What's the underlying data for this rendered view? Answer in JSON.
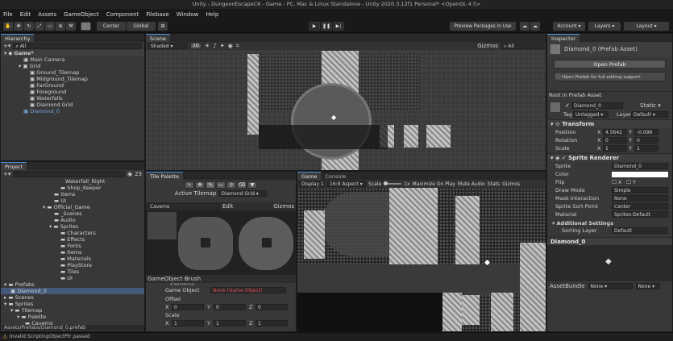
{
  "title": "Unity - DungeonEscapeC6 - Game - PC, Mac & Linux Standalone - Unity 2020.3.12f1 Personal* <OpenGL 4.5>",
  "menu": [
    "File",
    "Edit",
    "Assets",
    "GameObject",
    "Component",
    "Filebase",
    "Window",
    "Help"
  ],
  "toolbar": {
    "center": "Center",
    "global": "Global",
    "preview": "Preview Packages in Use",
    "account": "Account",
    "layers": "Layers",
    "layout": "Layout"
  },
  "hierarchy": {
    "tab": "Hierarchy",
    "search": "All",
    "items": [
      "Game*",
      "Main Camera",
      "Grid",
      "Ground_Tilemap",
      "Midground_Tilemap",
      "FarGround",
      "Foreground",
      "Waterfalls",
      "Diamond Grid",
      "Diamond_0"
    ]
  },
  "scene": {
    "tab": "Scene",
    "shading": "Shaded",
    "mode": "2D",
    "gizmos": "Gizmos",
    "search": "All"
  },
  "inspector": {
    "tab": "Inspector",
    "asset_title": "Diamond_0 (Prefab Asset)",
    "open_prefab": "Open Prefab",
    "open_note": "Open Prefab for full editing support.",
    "root": "Root in Prefab Asset",
    "name": "Diamond_0",
    "static": "Static",
    "tag_label": "Tag",
    "tag": "Untagged",
    "layer_label": "Layer",
    "layer": "Default",
    "transform": "Transform",
    "pos_label": "Position",
    "pos_x": "4.5642",
    "pos_y": "-0.096",
    "rot_label": "Rotation",
    "rot_x": "0",
    "rot_y": "0",
    "scale_label": "Scale",
    "scale_x": "1",
    "scale_y": "1",
    "sprite_renderer": "Sprite Renderer",
    "sprite_label": "Sprite",
    "sprite": "Diamond_0",
    "color_label": "Color",
    "flip_label": "Flip",
    "flip_x": "X",
    "flip_y": "Y",
    "draw_mode_label": "Draw Mode",
    "draw_mode": "Simple",
    "mask_label": "Mask Interaction",
    "mask": "None",
    "sort_point_label": "Sprite Sort Point",
    "sort_point": "Center",
    "material_label": "Material",
    "material": "Sprites-Default",
    "additional": "Additional Settings",
    "sorting_label": "Sorting Layer",
    "sorting": "Default",
    "preview_name": "Diamond_0",
    "assetbundle_label": "AssetBundle",
    "assetbundle": "None",
    "assetbundle2": "None"
  },
  "project": {
    "tab": "Project",
    "count": "23",
    "items": [
      "Waterfall_Right",
      "Shop_Keeper",
      "Items",
      "UI",
      "Official_Game",
      "_Scenes",
      "Audio",
      "Sprites",
      "Characters",
      "Effects",
      "Fonts",
      "Items",
      "Materials",
      "PlayStore",
      "Tiles",
      "UI",
      "Prefabs",
      "Diamond_0",
      "Scenes",
      "Sprites",
      "Tilemap",
      "Palette",
      "Caverns"
    ],
    "path": "Assets/Prefabs/Diamond_0.prefab"
  },
  "palette": {
    "tab": "Tile Palette",
    "active_label": "Active Tilemap",
    "active": "Diamond Grid",
    "palette_name": "Cavems",
    "edit": "Edit",
    "gizmos": "Gizmos",
    "brush": "GameObject Brush",
    "elements": "Elements",
    "game_object_label": "Game Object",
    "game_object": "None (Game Object)",
    "offset_label": "Offset",
    "offset_x": "0",
    "offset_y": "0",
    "offset_z": "0",
    "scale_label": "Scale",
    "scale_x": "1",
    "scale_y": "1",
    "scale_z": "1"
  },
  "game": {
    "tab_game": "Game",
    "tab_console": "Console",
    "display": "Display 1",
    "aspect": "16:9 Aspect",
    "scale_label": "Scale",
    "scale": "1x",
    "maximize": "Maximize On Play",
    "mute": "Mute Audio",
    "stats": "Stats",
    "gizmos": "Gizmos"
  },
  "status": "Invalid ScriptingObjectPtr passed"
}
